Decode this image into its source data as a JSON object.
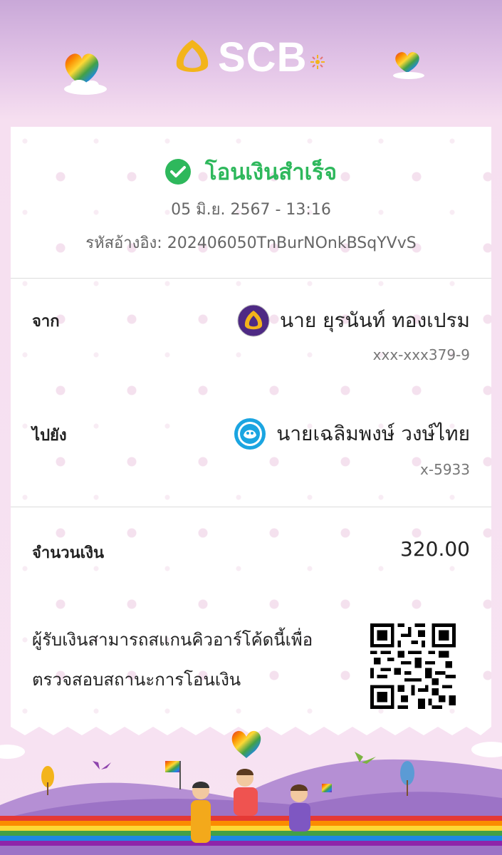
{
  "brand": {
    "name": "SCB"
  },
  "transfer": {
    "status": "โอนเงินสำเร็จ",
    "datetime": "05 มิ.ย. 2567 - 13:16",
    "reference_label": "รหัสอ้างอิง:",
    "reference_value": "202406050TnBurNOnkBSqYVvS"
  },
  "from": {
    "label": "จาก",
    "name": "นาย ยุรนันท์ ทองเปรม",
    "account": "xxx-xxx379-9",
    "bank_icon": "scb-bank-icon"
  },
  "to": {
    "label": "ไปยัง",
    "name": "นายเฉลิมพงษ์ วงษ์ไทย",
    "account": "x-5933",
    "bank_icon": "krungthai-bank-icon"
  },
  "amount": {
    "label": "จำนวนเงิน",
    "value": "320.00"
  },
  "qr": {
    "line1": "ผู้รับเงินสามารถสแกนคิวอาร์โค้ดนี้เพื่อ",
    "line2": "ตรวจสอบสถานะการโอนเงิน"
  },
  "colors": {
    "success": "#2eb85c",
    "scb_purple": "#4e2a84",
    "scb_gold": "#f3b41b",
    "ktb_blue": "#1ba5e1"
  }
}
